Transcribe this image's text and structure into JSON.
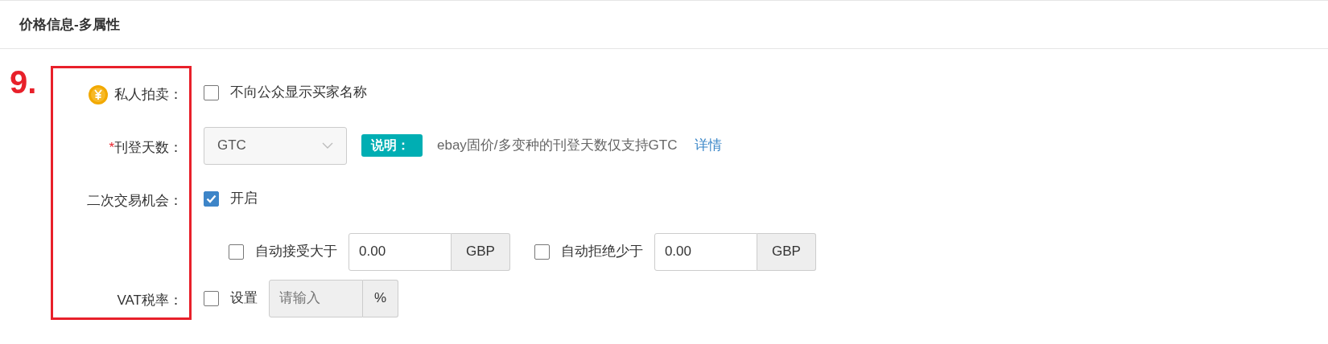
{
  "section": {
    "title": "价格信息-多属性"
  },
  "annotation": {
    "label": "9."
  },
  "rows": [
    {
      "kind": "checkbox",
      "label": "私人拍卖：",
      "paid_feature": true,
      "options": [
        {
          "label": "不向公众显示买家名称",
          "checked": false
        }
      ]
    },
    {
      "kind": "select",
      "label": "刊登天数：",
      "required": true,
      "required_mark": "*",
      "value": "GTC",
      "disabled": true,
      "note_badge": "说明：",
      "note": "ebay固价/多变种的刊登天数仅支持GTC",
      "link": "详情"
    },
    {
      "kind": "checkbox",
      "label": "二次交易机会：",
      "options": [
        {
          "label": "开启",
          "checked": true
        }
      ]
    },
    {
      "kind": "offers",
      "items": [
        {
          "label": "自动接受大于",
          "checked": false,
          "value": "0.00",
          "unit": "GBP"
        },
        {
          "label": "自动拒绝少于",
          "checked": false,
          "value": "0.00",
          "unit": "GBP"
        }
      ]
    },
    {
      "kind": "vat",
      "label": "VAT税率：",
      "checkbox_label": "设置",
      "checked": false,
      "placeholder": "请输入",
      "disabled": true,
      "unit": "%"
    }
  ]
}
